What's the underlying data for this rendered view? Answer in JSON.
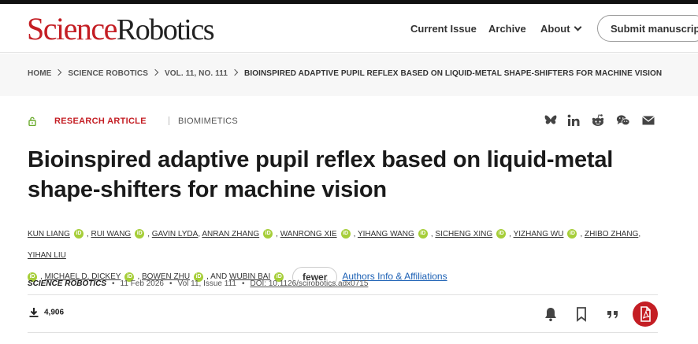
{
  "header": {
    "logo_part1": "Science",
    "logo_part2": "Robotics",
    "nav": [
      "Current Issue",
      "Archive",
      "About"
    ],
    "submit_label": "Submit manuscript"
  },
  "breadcrumb": {
    "items": [
      "HOME",
      "SCIENCE ROBOTICS",
      "VOL. 11, NO. 111",
      "BIOINSPIRED ADAPTIVE PUPIL REFLEX BASED ON LIQUID-METAL SHAPE-SHIFTERS FOR MACHINE VISION"
    ]
  },
  "article": {
    "type": "RESEARCH ARTICLE",
    "subject": "BIOMIMETICS",
    "title": "Bioinspired adaptive pupil reflex based on liquid-metal shape-shifters for machine vision",
    "authors": [
      "Kun Liang",
      "Rui Wang",
      "Gavin Lyda",
      "Anran Zhang",
      "Wanrong Xie",
      "Yihang Wang",
      "Sicheng Xing",
      "Yizhang Wu",
      "Zhibo Zhang",
      "Yihan Liu",
      "Michael D. Dickey",
      "Bowen Zhu",
      "Wubin Bai"
    ],
    "and_text": ", AND",
    "fewer_label": "fewer",
    "affiliations_label": "Authors Info & Affiliations",
    "journal": "SCIENCE ROBOTICS",
    "date": "11 Feb 2026",
    "volume": "Vol 11, Issue 111",
    "doi": "DOI: 10.1126/scirobotics.adx0715",
    "downloads": "4,906"
  },
  "icons": {
    "share": [
      "bluesky-icon",
      "linkedin-icon",
      "reddit-icon",
      "wechat-icon",
      "email-icon"
    ],
    "actions": [
      "bell-icon",
      "bookmark-icon",
      "quote-icon",
      "pdf-icon"
    ]
  },
  "colors": {
    "brand_red": "#c41e24",
    "orcid_green": "#a6ce39",
    "link_blue": "#1a5fb4"
  }
}
